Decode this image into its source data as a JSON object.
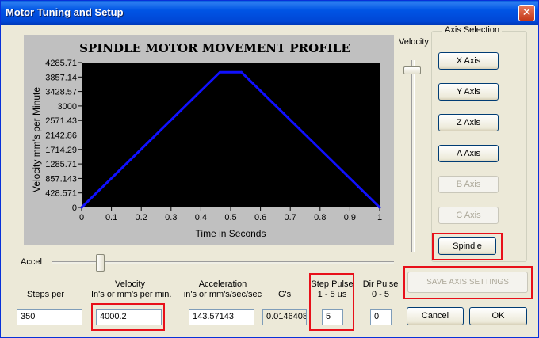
{
  "window": {
    "title": "Motor Tuning and Setup",
    "close_glyph": "✕"
  },
  "chart_data": {
    "type": "line",
    "title": "SPINDLE MOTOR MOVEMENT PROFILE",
    "xlabel": "Time in Seconds",
    "ylabel": "Velocity mm's per Minute",
    "xlim": [
      0,
      1
    ],
    "ylim": [
      0,
      4285.71
    ],
    "x_ticks": [
      "0",
      "0.1",
      "0.2",
      "0.3",
      "0.4",
      "0.5",
      "0.6",
      "0.7",
      "0.8",
      "0.9",
      "1"
    ],
    "y_ticks": [
      "4285.71",
      "3857.14",
      "3428.57",
      "3000",
      "2571.43",
      "2142.86",
      "1714.29",
      "1285.71",
      "857.143",
      "428.571",
      "0"
    ],
    "series": [
      {
        "color": "#1010ff",
        "x": [
          0,
          0.464,
          0.536,
          1
        ],
        "y": [
          0,
          4000,
          4000,
          0
        ]
      }
    ],
    "plot_background": "#000000",
    "grid": false
  },
  "velocity_slider": {
    "label": "Velocity"
  },
  "accel_slider": {
    "label": "Accel"
  },
  "axis_selection": {
    "title": "Axis Selection",
    "buttons": [
      {
        "label": "X Axis",
        "enabled": true
      },
      {
        "label": "Y Axis",
        "enabled": true
      },
      {
        "label": "Z Axis",
        "enabled": true
      },
      {
        "label": "A Axis",
        "enabled": true
      },
      {
        "label": "B Axis",
        "enabled": false
      },
      {
        "label": "C Axis",
        "enabled": false
      },
      {
        "label": "Spindle",
        "enabled": true
      }
    ]
  },
  "fields": {
    "steps_per": {
      "label": "Steps per",
      "value": "350"
    },
    "velocity": {
      "label_line1": "Velocity",
      "label_line2": "In's or mm's per min.",
      "value": "4000.2"
    },
    "acceleration": {
      "label_line1": "Acceleration",
      "label_line2": "in's or mm's/sec/sec",
      "value": "143.57143"
    },
    "gs": {
      "label": "G's",
      "value": "0.0146408"
    },
    "step_pulse": {
      "label_line1": "Step Pulse",
      "label_line2": "1 - 5 us",
      "value": "5"
    },
    "dir_pulse": {
      "label_line1": "Dir Pulse",
      "label_line2": "0 - 5",
      "value": "0"
    }
  },
  "buttons": {
    "save": "SAVE AXIS SETTINGS",
    "cancel": "Cancel",
    "ok": "OK"
  },
  "highlight_color": "#e8101a"
}
